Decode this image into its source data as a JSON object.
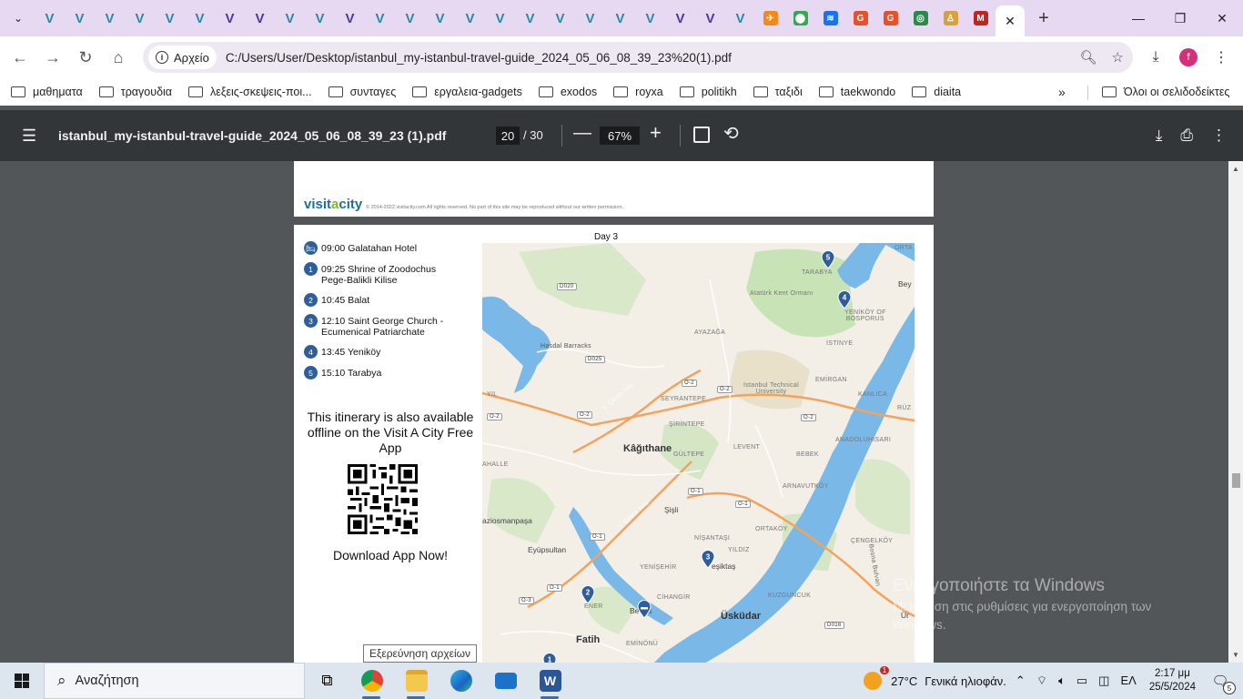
{
  "browser": {
    "tab_favicons": [
      {
        "kind": "v",
        "name": "visitacity-tab-icon"
      },
      {
        "kind": "v",
        "name": "visitacity-tab-icon"
      },
      {
        "kind": "v",
        "name": "visitacity-tab-icon"
      },
      {
        "kind": "v",
        "name": "visitacity-tab-icon"
      },
      {
        "kind": "v",
        "name": "visitacity-tab-icon"
      },
      {
        "kind": "v",
        "name": "visitacity-tab-icon"
      },
      {
        "kind": "v2",
        "name": "v-tab-icon"
      },
      {
        "kind": "v2",
        "name": "v-tab-icon"
      },
      {
        "kind": "v",
        "name": "visitacity-tab-icon"
      },
      {
        "kind": "v",
        "name": "visitacity-tab-icon"
      },
      {
        "kind": "v2",
        "name": "v-tab-icon"
      },
      {
        "kind": "v",
        "name": "visitacity-tab-icon"
      },
      {
        "kind": "v",
        "name": "visitacity-tab-icon"
      },
      {
        "kind": "v",
        "name": "visitacity-tab-icon"
      },
      {
        "kind": "v",
        "name": "visitacity-tab-icon"
      },
      {
        "kind": "v",
        "name": "visitacity-tab-icon"
      },
      {
        "kind": "v",
        "name": "visitacity-tab-icon"
      },
      {
        "kind": "v",
        "name": "visitacity-tab-icon"
      },
      {
        "kind": "v",
        "name": "visitacity-tab-icon"
      },
      {
        "kind": "v",
        "name": "visitacity-tab-icon"
      },
      {
        "kind": "v",
        "name": "visitacity-tab-icon"
      },
      {
        "kind": "v2",
        "name": "v-tab-icon"
      },
      {
        "kind": "v2",
        "name": "v-tab-icon"
      },
      {
        "kind": "v",
        "name": "visitacity-tab-icon"
      },
      {
        "kind": "fav",
        "color": "#f28a1a",
        "glyph": "✈",
        "name": "flight-tab-icon"
      },
      {
        "kind": "fav",
        "color": "#34a853",
        "glyph": "⬤",
        "name": "maps-tab-icon"
      },
      {
        "kind": "fav",
        "color": "#1a73e8",
        "glyph": "≋",
        "name": "weather-tab-icon"
      },
      {
        "kind": "fav",
        "color": "#e8502a",
        "glyph": "G",
        "name": "g-tab-icon"
      },
      {
        "kind": "fav",
        "color": "#e8502a",
        "glyph": "G",
        "name": "g-tab-icon"
      },
      {
        "kind": "fav",
        "color": "#2b8a4a",
        "glyph": "◎",
        "name": "tripadvisor-tab-icon"
      },
      {
        "kind": "fav",
        "color": "#d9a040",
        "glyph": "♙",
        "name": "figure-tab-icon"
      },
      {
        "kind": "fav",
        "color": "#c5221f",
        "glyph": "M",
        "name": "gmail-tab-icon"
      }
    ],
    "active_tab_close": "✕",
    "new_tab": "+",
    "window_controls": {
      "minimize": "—",
      "restore": "❐",
      "close": "✕"
    },
    "security_chip": "Αρχείο",
    "url": "C:/Users/User/Desktop/istanbul_my-istanbul-travel-guide_2024_05_06_08_39_23%20(1).pdf",
    "profile_initial": "f",
    "bookmarks": [
      "μαθηματα",
      "τραγουδια",
      "λεξεις-σκεψεις-ποι...",
      "συνταγες",
      "εργαλεια-gadgets",
      "exodos",
      "royxa",
      "politikh",
      "ταξιδι",
      "taekwondo",
      "diaita"
    ],
    "bookmarks_more": "»",
    "all_bookmarks": "Όλοι οι σελιδοδείκτες"
  },
  "pdf": {
    "title": "istanbul_my-istanbul-travel-guide_2024_05_06_08_39_23 (1).pdf",
    "page_current": "20",
    "page_total": "/ 30",
    "zoom": "67%",
    "logo_main": "visit",
    "logo_accent": "a",
    "logo_end": "city",
    "copyright": "© 2014-2022 visitacity.com All rights reserved. No part of this site may be reproduced without our written permission.",
    "day_label": "Day 3",
    "itinerary": [
      {
        "marker": "🛏",
        "text": "09:00 Galatahan Hotel"
      },
      {
        "marker": "1",
        "text": "09:25 Shrine of Zoodochus\n      Pege-Balikli Kilise"
      },
      {
        "marker": "2",
        "text": "10:45 Balat"
      },
      {
        "marker": "3",
        "text": "12:10 Saint George Church -\n      Ecumenical Patriarchate"
      },
      {
        "marker": "4",
        "text": "13:45 Yeniköy"
      },
      {
        "marker": "5",
        "text": "15:10 Tarabya"
      }
    ],
    "offline_text": "This itinerary is also available offline on the Visit A City Free App",
    "download_text": "Download App Now!",
    "map_labels": {
      "kagithane": "Kâğıthane",
      "sisli": "Şişli",
      "uskudar": "Üsküdar",
      "eyupsultan": "Eyüpsultan",
      "fatih": "Fatih",
      "gaziosmanpasa": "aziosmanpaşa",
      "beyoglu": "Be  ğlu",
      "besiktas": "eşiktaş",
      "hasdal": "Hasdal Barracks",
      "ataturk": "Atatürk Kent Ormanı",
      "itu": "Istanbul Technical\nUniversity",
      "tarabya": "TARABYA",
      "yenikoy": "YENİKÖY OF\nBOSPORUS",
      "istinye": "İSTİNYE",
      "emirgan": "EMİRGAN",
      "kanlica": "KANLICA",
      "ayazaga": "AYAZAĞA",
      "seyrantepe": "SEYRANTEPE",
      "sirintepe": "ŞİRİNTEPE",
      "gultepe": "GÜLTEPE",
      "levent": "LEVENT",
      "bebek": "BEBEK",
      "anadoluhisari": "ANADOLUHİSARI",
      "arnavutkoy": "ARNAVUTKÖY",
      "ortakoy": "ORTAKÖY",
      "cengelkoy": "ÇENGELKÖY",
      "yildiz": "YILDIZ",
      "nisantasi": "NİŞANTAŞI",
      "yenisehir": "YENİŞEHİR",
      "cihangir": "CİHANGİR",
      "kuzguncuk": "KUZGUNCUK",
      "emirnonu": "EMİNÖNÜ",
      "ahalle": "AHALLE",
      "ener": "ENER",
      "yil": "YIL",
      "orta": "ORTA",
      "bey": "Bey",
      "ruz": "RÜZ",
      "ur": "Ür",
      "bosna": "Bosna Bulvarı",
      "cevre1": "1. Çevre Yolu",
      "cevre2": "1. Çevre Yolu",
      "d020": "D020",
      "d025": "D025",
      "o2a": "O-2",
      "o2b": "O-2",
      "o2c": "O-2",
      "o2d": "O-2",
      "o2e": "O-2",
      "o1a": "O-1",
      "o1b": "O-1",
      "o1c": "O-1",
      "o1d": "O-1",
      "o3": "O-3",
      "d016": "D016"
    }
  },
  "tooltip": "Εξερεύνηση αρχείων",
  "watermark": {
    "line1": "Ενεργοποιήστε τα Windows",
    "line2": "Μετάβαση στις ρυθμίσεις για ενεργοποίηση των Windows."
  },
  "taskbar": {
    "search_placeholder": "Αναζήτηση",
    "weather_badge": "1",
    "weather_temp": "27°C",
    "weather_desc": "Γενικά ηλιοφάν.",
    "language": "ΕΛ",
    "time": "2:17 μμ",
    "date": "25/5/2024",
    "notifications": "5"
  },
  "colors": {
    "pin": "#2f5f9a",
    "water": "#7ab8e8",
    "park": "#c8e3b5",
    "road_major": "#f3a35c"
  }
}
